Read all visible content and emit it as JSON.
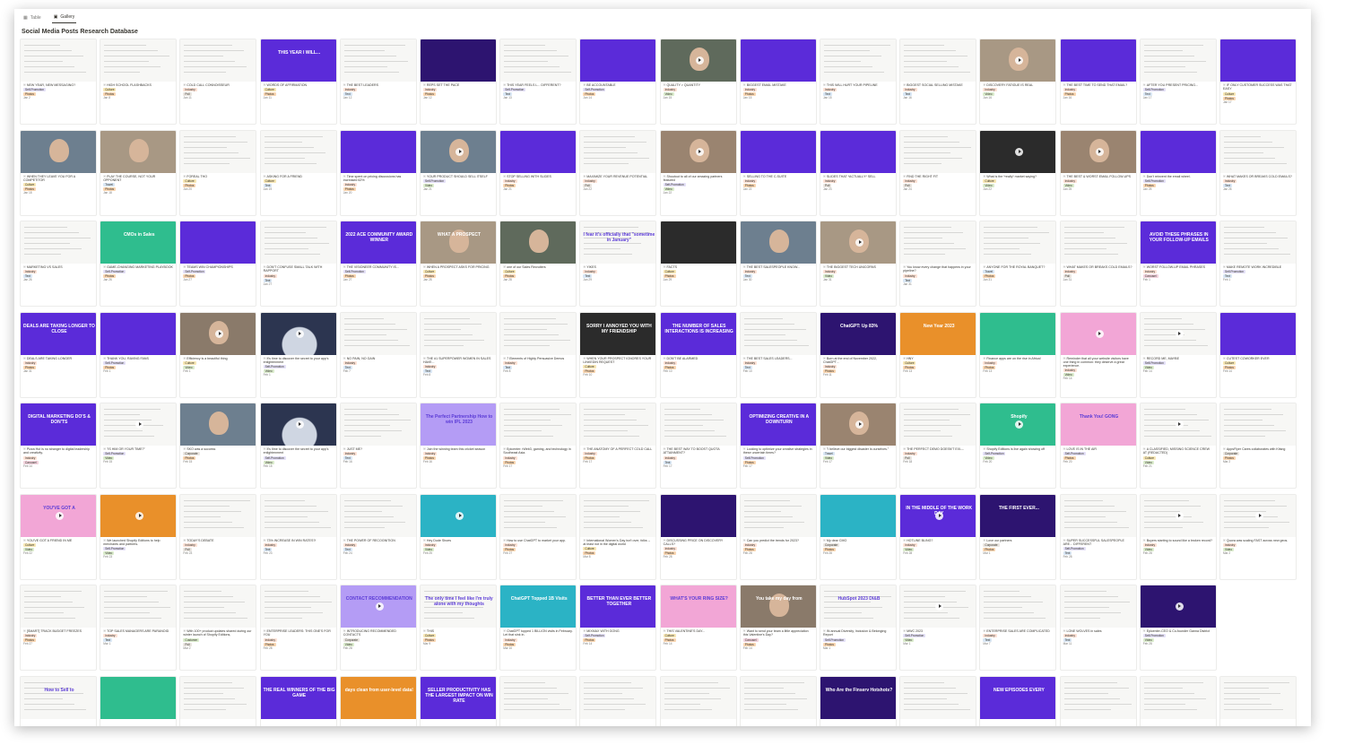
{
  "tabs": [
    {
      "icon": "table-icon",
      "label": "Table"
    },
    {
      "icon": "gallery-icon",
      "label": "Gallery"
    }
  ],
  "active_tab": "Gallery",
  "title": "Social Media Posts Research Database",
  "colors": {
    "purple": "#5b2bd9",
    "deep": "#2d1470",
    "lav": "#b49cf5",
    "pink": "#f2a6d6",
    "green": "#2fbd8e",
    "orange": "#e9902a",
    "teal": "#2bb3c5",
    "dark": "#2b2b2b",
    "tagInd": "#fde2d6",
    "tagCul": "#f7e7b5",
    "tagSelf": "#e4e0f7",
    "tagPhoto": "#f9d6b2",
    "tagText": "#d9e7f5",
    "tagVideo": "#dbeccd",
    "tagCorp": "#eae6e1",
    "tagCar": "#f2d3dd"
  },
  "cards": [
    {
      "t": "NEW YEAR, NEW MESSAGING?",
      "c": "Self-Promotion",
      "m": "Photos",
      "d": "Jan 2"
    },
    {
      "t": "HIGH SCHOOL FLASHBACKS",
      "c": "Culture",
      "m": "Photos",
      "d": "Jan 8"
    },
    {
      "t": "COLD CALL CONNOISSEUR",
      "c": "Industry",
      "m": "Poll",
      "d": "Jan 11"
    },
    {
      "t": "WORDS OF AFFIRMATION",
      "c": "Culture",
      "m": "Photos",
      "d": "Jan 11",
      "x": "THIS YEAR I WILL..."
    },
    {
      "t": "THE BEST LEADERS",
      "c": "Industry",
      "m": "Text",
      "d": "Jan 12"
    },
    {
      "t": "REPS SET THE PACE",
      "c": "Industry",
      "m": "Photos",
      "d": "Jan 12"
    },
    {
      "t": "THIS YEAR FEELS L... DIFFERENT?",
      "c": "Self-Promotion",
      "m": "Text",
      "d": "Jan 13"
    },
    {
      "t": "BE ACCOUNTABLE",
      "c": "Self-Promotion",
      "m": "Photos",
      "d": "Jan 14"
    },
    {
      "t": "QUALITY > QUANTITY",
      "c": "Industry",
      "m": "Video",
      "d": "Jan 15"
    },
    {
      "t": "BIGGEST EMAIL MISTAKE",
      "c": "Industry",
      "m": "Photos",
      "d": "Jan 15"
    },
    {
      "t": "THIS WILL HURT YOUR PIPELINE",
      "c": "Industry",
      "m": "Text",
      "d": "Jan 15"
    },
    {
      "t": "BIGGEST SOCIAL SELLING MISTAKE",
      "c": "Industry",
      "m": "Text",
      "d": "Jan 16"
    },
    {
      "t": "DISCOVERY FATIGUE IS REAL",
      "c": "Industry",
      "m": "Video",
      "d": "Jan 16"
    },
    {
      "t": "THE BEST TIME TO SEND THAT EMAIL?",
      "c": "Industry",
      "m": "Photos",
      "d": "Jan 16"
    },
    {
      "t": "AFTER YOU PRESENT PRICING...",
      "c": "Self-Promotion",
      "m": "Text",
      "d": "Jan 17"
    },
    {
      "t": "IF ONLY CUSTOMER SUCCESS WAS THAT EASY",
      "c": "Culture",
      "m": "Photos",
      "d": "Jan 17"
    },
    {
      "t": "WHEN THEY LEAVE YOU FOR A COMPETITOR",
      "c": "Culture",
      "m": "Photos",
      "d": "Jan 18"
    },
    {
      "t": "PLAY THE COURSE, NOT YOUR OPPONENT",
      "c": "Travel",
      "m": "Photos",
      "d": "Jan 18"
    },
    {
      "t": "FOREAL THO",
      "c": "Culture",
      "m": "Photos",
      "d": "Jan 20"
    },
    {
      "t": "ASKING FOR A FRIEND",
      "c": "Culture",
      "m": "Text",
      "d": "Jan 19"
    },
    {
      "t": "Time spent on pricing discussions has increased 62%",
      "c": "Industry",
      "m": "Photos",
      "d": "Jan 20"
    },
    {
      "t": "YOUR PRODUCT SHOULD SELL ITSELF",
      "c": "Self-Promotion",
      "m": "Video",
      "d": "Jan 21"
    },
    {
      "t": "STOP SELLING WITH SLIDES",
      "c": "Industry",
      "m": "Photos",
      "d": "Jan 21"
    },
    {
      "t": "MAXIMIZE YOUR REVENUE POTENTIAL",
      "c": "Industry",
      "m": "Poll",
      "d": "Jan 22"
    },
    {
      "t": "Shoutout to all of our amazing partners featured",
      "c": "Self-Promotion",
      "m": "Video",
      "d": "Jan 22"
    },
    {
      "t": "SELLING TO THE C-SUITE",
      "c": "Industry",
      "m": "Photos",
      "d": "Jan 22"
    },
    {
      "t": "SLIDES THAT *ACTUALLY* SELL",
      "c": "Industry",
      "m": "Poll",
      "d": "Jan 23"
    },
    {
      "t": "FIND THE RIGHT FIT",
      "c": "Industry",
      "m": "Poll",
      "d": "Jan 24"
    },
    {
      "t": "What is the *really* market saying?",
      "c": "Culture",
      "m": "Video",
      "d": "Jan 22"
    },
    {
      "t": "THE BEST & WORST EMAIL FOLLOW-UPS",
      "c": "Industry",
      "m": "Video",
      "d": "Jan 25"
    },
    {
      "t": "Don't reinvent the email wheel.",
      "c": "Self-Promotion",
      "m": "Photos",
      "d": "Jan 25"
    },
    {
      "t": "WHAT MAKES OR BREAKS COLD EMAILS?",
      "c": "Industry",
      "m": "Text",
      "d": "Jan 26"
    },
    {
      "t": "MARKETING VS SALES",
      "c": "Industry",
      "m": "Text",
      "d": "Jan 26"
    },
    {
      "t": "GAME-CHANGING MARKETING PLAYBOOK",
      "c": "Self-Promotion",
      "m": "Photos",
      "d": "Jan 26",
      "x": "CMOs in Sales"
    },
    {
      "t": "TEAMS WIN CHAMPIONSHIPS",
      "c": "Self-Promotion",
      "m": "Photos",
      "d": "Jan 27"
    },
    {
      "t": "DON'T CONFUSE SMALL TALK WITH RAPPORT",
      "c": "Industry",
      "m": "Text",
      "d": "Jan 27"
    },
    {
      "t": "THE VISIONEER COMMUNITY IS...",
      "c": "Self-Promotion",
      "m": "Photos",
      "d": "Jan 27",
      "x": "2022 ACE COMMUNITY AWARD WINNER"
    },
    {
      "t": "WHEN A PROSPECT ASKS FOR PRICING",
      "c": "Culture",
      "m": "Photos",
      "d": "Jan 28",
      "x": "WHAT A PROSPECT"
    },
    {
      "t": "one of our Sales Recruiters",
      "c": "Culture",
      "m": "Photos",
      "d": "Jan 28"
    },
    {
      "t": "YIKES",
      "c": "Industry",
      "m": "Text",
      "d": "Jan 29",
      "x": "I fear it's officially that \"sometime in January\""
    },
    {
      "t": "FACTS",
      "c": "Culture",
      "m": "Photos",
      "d": "Jan 29"
    },
    {
      "t": "THE BEST SALESPEOPLE KNOW...",
      "c": "Industry",
      "m": "Text",
      "d": "Jan 30"
    },
    {
      "t": "THE BIGGEST TECH UNICORNS",
      "c": "Industry",
      "m": "Video",
      "d": "Jan 31"
    },
    {
      "t": "You know every change that happens in your pipeline?",
      "c": "Industry",
      "m": "Text",
      "d": "Jan 31"
    },
    {
      "t": "ANYONE FOR THE ROYAL BANQUET?",
      "c": "Travel",
      "m": "Photos",
      "d": "Jan 31"
    },
    {
      "t": "WHAT MAKES OR BREAKS COLD EMAILS?",
      "c": "Industry",
      "m": "Poll",
      "d": "Jan 31"
    },
    {
      "t": "WORST FOLLOW-UP EMAIL PHRASES",
      "c": "Industry",
      "m": "Carousel",
      "d": "Feb 1",
      "x": "AVOID THESE PHRASES IN YOUR FOLLOW-UP EMAILS"
    },
    {
      "t": "MAKE REMOTE WORK INCREDIBLE",
      "c": "Self-Promotion",
      "m": "Text",
      "d": "Feb 1"
    },
    {
      "t": "DEALS ARE TAKING LONGER",
      "c": "Industry",
      "m": "Photos",
      "d": "Jan 31",
      "x": "DEALS ARE TAKING LONGER TO CLOSE"
    },
    {
      "t": "THANK YOU, RAVING FANS",
      "c": "Self-Promotion",
      "m": "Photos",
      "d": "Feb 1"
    },
    {
      "t": "Efficiency is a beautiful thing",
      "c": "Culture",
      "m": "Video",
      "d": "Feb 1"
    },
    {
      "t": "It's time to discover the secret to your app's enlightenment",
      "c": "Self-Promotion",
      "m": "Video",
      "d": "Feb 1"
    },
    {
      "t": "NO PAIN, NO GAIN",
      "c": "Industry",
      "m": "Text",
      "d": "Feb 7"
    },
    {
      "t": "THE #1 SUPERPOWER WOMEN IN SALES HAVE...",
      "c": "Industry",
      "m": "Text",
      "d": "Feb 8"
    },
    {
      "t": "7 Elements of Highly Persuasive Demos",
      "c": "Industry",
      "m": "Text",
      "d": "Feb 8"
    },
    {
      "t": "WHEN YOUR PROSPECT IGNORES YOUR LINKEDIN REQUEST",
      "c": "Culture",
      "m": "Photos",
      "d": "Feb 10",
      "x": "SORRY I ANNOYED YOU WITH MY FRIENDSHIP"
    },
    {
      "t": "DON'T BE ALARMED",
      "c": "Industry",
      "m": "Photos",
      "d": "Feb 10",
      "x": "THE NUMBER OF SALES INTERACTIONS IS INCREASING"
    },
    {
      "t": "THE BEST SALES LEADERS...",
      "c": "Industry",
      "m": "Text",
      "d": "Feb 10"
    },
    {
      "t": "Born at the end of November 2022, ChatGPT...",
      "c": "Industry",
      "m": "Photos",
      "d": "Feb 11",
      "x": "ChatGPT: Up 83%"
    },
    {
      "t": "HNY",
      "c": "Culture",
      "m": "Photos",
      "d": "Feb 13",
      "x": "New Year 2023"
    },
    {
      "t": "Finance apps are on the rise in Africa!",
      "c": "Industry",
      "m": "Photos",
      "d": "Feb 13"
    },
    {
      "t": "Reminder that all your website visitors have one thing in common: they deserve a great experience.",
      "c": "Industry",
      "m": "Video",
      "d": "Feb 14"
    },
    {
      "t": "RECORD ME, MAYBE",
      "c": "Self-Promotion",
      "m": "Video",
      "d": "Feb 14"
    },
    {
      "t": "CUTEST COWORKER EVER",
      "c": "Culture",
      "m": "Photos",
      "d": "Feb 14"
    },
    {
      "t": "Pizza Hut is no stranger to digital leadership and creativity.",
      "c": "Industry",
      "m": "Carousel",
      "d": "Feb 14",
      "x": "DIGITAL MARKETING DO'S & DON'TS"
    },
    {
      "t": "\"IS HIM OR YOUR TIME?\"",
      "c": "Self-Promotion",
      "m": "Video",
      "d": "Feb 15"
    },
    {
      "t": "SKO was a success",
      "c": "Corporate",
      "m": "Photos",
      "d": "Feb 15"
    },
    {
      "t": "It's time to discover the secret to your app's enlightenment",
      "c": "Self-Promotion",
      "m": "Video",
      "d": "Feb 15"
    },
    {
      "t": "JUST ME?",
      "c": "Industry",
      "m": "Text",
      "d": "Feb 16"
    },
    {
      "t": "Join the winning team this cricket season",
      "c": "Industry",
      "m": "Photos",
      "d": "Feb 16",
      "x": "The Perfect Partnership How to win IPL 2023"
    },
    {
      "t": "Epicenter: rWeb3, gaming, and technology in Southeast Asia.",
      "c": "Industry",
      "m": "Photos",
      "d": "Feb 17"
    },
    {
      "t": "THE ANATOMY OF A PERFECT COLD CALL",
      "c": "Industry",
      "m": "Photos",
      "d": "Feb 17"
    },
    {
      "t": "THE BEST WAY TO BOOST QUOTA ATTAINMENT?",
      "c": "Industry",
      "m": "Text",
      "d": "Feb 17"
    },
    {
      "t": "Looking to optimize your creative strategies in these uncertain times?",
      "c": "Self-Promotion",
      "m": "Photos",
      "d": "Feb 17",
      "x": "OPTIMIZING CREATIVE IN A DOWNTURN"
    },
    {
      "t": "\"I believe our biggest disaster is ourselves.\"",
      "c": "Travel",
      "m": "Video",
      "d": "Feb 17"
    },
    {
      "t": "THE PERFECT DEMO DOESN'T EXI---",
      "c": "Industry",
      "m": "Poll",
      "d": "Feb 18"
    },
    {
      "t": "Shopify Editions is live again showing off",
      "c": "Self-Promotion",
      "m": "Video",
      "d": "Feb 20",
      "x": "Shopify"
    },
    {
      "t": "LOVE IS IN THE AIR",
      "c": "Self-Promotion",
      "m": "Photos",
      "d": "Feb 20",
      "x": "Thank You! GONG"
    },
    {
      "t": "A CLASSIFIED, MISSING SCIENCE CREW AT (REDACTED)",
      "c": "Culture",
      "m": "Video",
      "d": "Feb 21"
    },
    {
      "t": "AppsFlyer Cares collaborates with Kitsng",
      "c": "Corporate",
      "m": "Photos",
      "d": "Mar 2"
    },
    {
      "t": "YOU'VE GOT A FRIEND IN ME",
      "c": "Culture",
      "m": "Video",
      "d": "Feb 22",
      "x": "YOU'VE GOT A"
    },
    {
      "t": "We launched Shopify Editions to help merchants and partners.",
      "c": "Self-Promotion",
      "m": "Video",
      "d": "Feb 23"
    },
    {
      "t": "TODAY'S DEBATE",
      "c": "Industry",
      "m": "Poll",
      "d": "Feb 23"
    },
    {
      "t": "73% INCREASE IN WIN RATES?!",
      "c": "Industry",
      "m": "Text",
      "d": "Feb 23"
    },
    {
      "t": "THE POWER OF RECOGNITION",
      "c": "Industry",
      "m": "Text",
      "d": "Feb 24"
    },
    {
      "t": "Hey Dude Shoes",
      "c": "Industry",
      "m": "Video",
      "d": "Feb 25"
    },
    {
      "t": "How to use ChatGPT to market your app.",
      "c": "Industry",
      "m": "Photos",
      "d": "Feb 27"
    },
    {
      "t": "International Women's Day isn't over, folks -- at least not in the digital world",
      "c": "Culture",
      "m": "Photos",
      "d": "Mar 8"
    },
    {
      "t": "DISCUSSING PRICE ON DISCOVERY CALLS?",
      "c": "Industry",
      "m": "Photos",
      "d": "Feb 28"
    },
    {
      "t": "Can you predict the trends for 2023?",
      "c": "Industry",
      "m": "Photos",
      "d": "Feb 28"
    },
    {
      "t": "My dear CMO",
      "c": "Corporate",
      "m": "Photos",
      "d": "Feb 28"
    },
    {
      "t": "HOTLINE BLING?",
      "c": "Industry",
      "m": "Video",
      "d": "Feb 28",
      "x": "IN THE MIDDLE OF THE WORK DAY"
    },
    {
      "t": "Love our partners",
      "c": "Corporate",
      "m": "Photos",
      "d": "Mar 1",
      "x": "THE FIRST EVER..."
    },
    {
      "t": "SUPER SUCCESSFUL SALESPEOPLE ARE... DIFFERENT",
      "c": "Self-Promotion",
      "m": "Text",
      "d": "Feb 28"
    },
    {
      "t": "Buyers starting to sound like a broken record?",
      "c": "Industry",
      "m": "Video",
      "d": "Feb 28"
    },
    {
      "t": "Quora was scaling FAST across new geos.",
      "c": "Industry",
      "m": "Video",
      "d": "Mar 2"
    },
    {
      "t": "[SMART] TRACK BUDGET FREEZES",
      "c": "Industry",
      "m": "Photos",
      "d": "Feb 27"
    },
    {
      "t": "TOP SALES MANAGERS ARE PARANOID",
      "c": "Industry",
      "m": "Text",
      "d": "Mar 1"
    },
    {
      "t": "With 100+ product updates shared during our winter launch of Shopify Editions,",
      "c": "Customer",
      "m": "Poll",
      "d": "Mar 2"
    },
    {
      "t": "ENTERPRISE LEADERS: THIS ONE'S FOR YOU",
      "c": "Industry",
      "m": "Photos",
      "d": "Feb 28"
    },
    {
      "t": "INTRODUCING RECOMMENDED CONTACTS",
      "c": "Corporate",
      "m": "Video",
      "d": "Feb 28",
      "x": "CONTACT RECOMMENDATION"
    },
    {
      "t": "THIS",
      "c": "Culture",
      "m": "Photos",
      "d": "Mar 9",
      "x": "The only time I feel like I'm truly alone with my thoughts"
    },
    {
      "t": "ChatGPT topped 1 BILLION visits in February. Let that sink in.",
      "c": "Industry",
      "m": "Photos",
      "d": "Mar 10",
      "x": "ChatGPT Topped 1B Visits"
    },
    {
      "t": "MIXMAX WITH GONG",
      "c": "Self-Promotion",
      "m": "Photos",
      "d": "Feb 14",
      "x": "BETTER THAN EVER BETTER TOGETHER"
    },
    {
      "t": "THIS VALENTINE'S DAY...",
      "c": "Culture",
      "m": "Photos",
      "d": "Feb 14",
      "x": "WHAT'S YOUR RING SIZE?"
    },
    {
      "t": "Want to send your team a little appreciation this Valentine's Day?",
      "c": "Carousel",
      "m": "Photos",
      "d": "Feb 14",
      "x": "You take my day from"
    },
    {
      "t": "IN annual Diversity, Inclusion & Belonging Report",
      "c": "Self-Promotion",
      "m": "Photos",
      "d": "Mar 1",
      "x": "HubSpot 2023 DI&B"
    },
    {
      "t": "MWC 2023",
      "c": "Self-Promotion",
      "m": "Video",
      "d": "Mar 1"
    },
    {
      "t": "ENTERPRISE SALES ARE COMPLICATED",
      "c": "Industry",
      "m": "Text",
      "d": "Mar 7"
    },
    {
      "t": "LONE WOLVES in sales",
      "c": "Industry",
      "m": "Text",
      "d": "Mar 11"
    },
    {
      "t": "Epicenter-CEO & Co-founder Ganna District",
      "c": "Self-Promotion",
      "m": "Video",
      "d": "Feb 28"
    }
  ],
  "partial_cards": [
    {
      "x": "How to Sell to"
    },
    {
      "x": ""
    },
    {
      "x": ""
    },
    {
      "x": "THE REAL WINNERS OF THE BIG GAME"
    },
    {
      "x": "days clean from user-level data!"
    },
    {
      "x": "SELLER PRODUCTIVITY HAS THE LARGEST IMPACT ON WIN RATE"
    },
    {
      "x": ""
    },
    {
      "x": ""
    },
    {
      "x": ""
    },
    {
      "x": ""
    },
    {
      "x": "Who Are the Finserv Hotshots?"
    },
    {
      "x": ""
    },
    {
      "x": "NEW EPISODES EVERY"
    },
    {
      "x": ""
    },
    {
      "x": ""
    },
    {
      "x": ""
    }
  ]
}
